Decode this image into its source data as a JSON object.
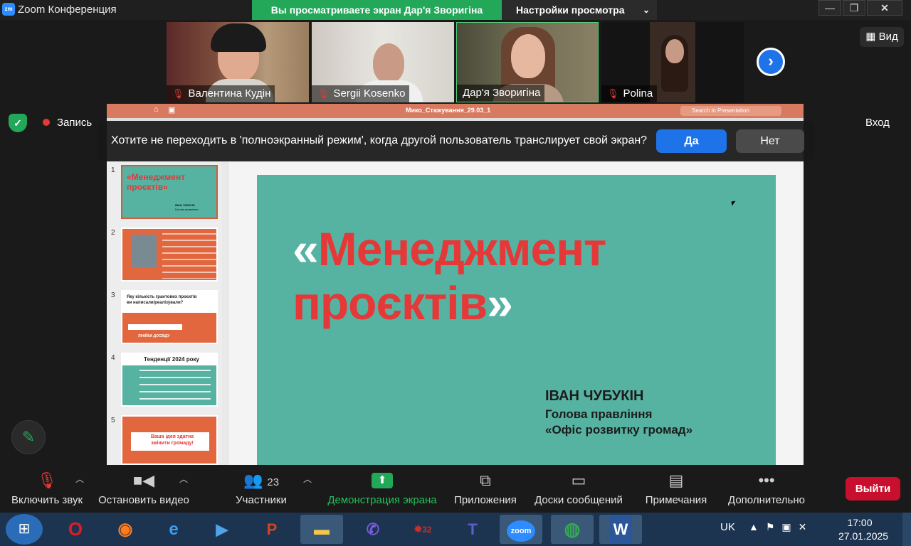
{
  "window": {
    "app_logo_text": "zm",
    "app_title": "Zoom Конференция",
    "share_banner": "Вы просматриваете экран Дар'я Зворигіна",
    "view_settings_label": "Настройки просмотра"
  },
  "gallery": {
    "participants": [
      {
        "name": "Валентина Кудін",
        "muted": true
      },
      {
        "name": "Sergii Kosenko",
        "muted": true
      },
      {
        "name": "Дар'я Зворигіна",
        "muted": false
      },
      {
        "name": "Polina",
        "muted": true
      }
    ],
    "view_label": "Вид"
  },
  "status": {
    "record_label": "Запись",
    "signin_label": "Вход"
  },
  "prompt": {
    "text": "Хотите не переходить в 'полноэкранный режим', когда другой пользователь транслирует свой экран?",
    "yes": "Да",
    "no": "Нет"
  },
  "shared_screen": {
    "file_name": "Мико_Стажування_29.03_1",
    "search_placeholder": "Search in Presentation",
    "slide_numbers": [
      "1",
      "2",
      "3",
      "4",
      "5"
    ],
    "thumbnails": {
      "slide1_title": "«Менеджмент проєктів»",
      "slide3_title": "Яку кількість грантових проєктів ви написали/реалізували?",
      "slide3_caption": "ЛІНІЙКА ДОСВІДУ",
      "slide4_title": "Тенденції 2024 року",
      "slide5_title": "Ваша ідея здатна змінити громаду!"
    },
    "slide": {
      "title_open": "«",
      "title_line1": "Менеджмент",
      "title_line2": "проєктів",
      "title_close": "»",
      "author_name": "ІВАН ЧУБУКІН",
      "author_role": "Голова правління",
      "author_org": "«Офіс розвитку громад»"
    }
  },
  "toolbar": {
    "unmute": "Включить звук",
    "stop_video": "Остановить видео",
    "participants": "Участники",
    "participants_count": "23",
    "share_screen": "Демонстрация экрана",
    "apps": "Приложения",
    "whiteboards": "Доски сообщений",
    "notes": "Примечания",
    "more": "Дополнительно",
    "leave": "Выйти"
  },
  "taskbar": {
    "zoom_label": "zoom",
    "game_badge": "32",
    "language": "UK",
    "time": "17:00",
    "date": "27.01.2025"
  },
  "colors": {
    "share_green": "#23a859",
    "zoom_blue": "#1f73e8",
    "leave_red": "#c8102e",
    "slide_teal": "#56b3a2",
    "slide_red": "#e53838"
  }
}
